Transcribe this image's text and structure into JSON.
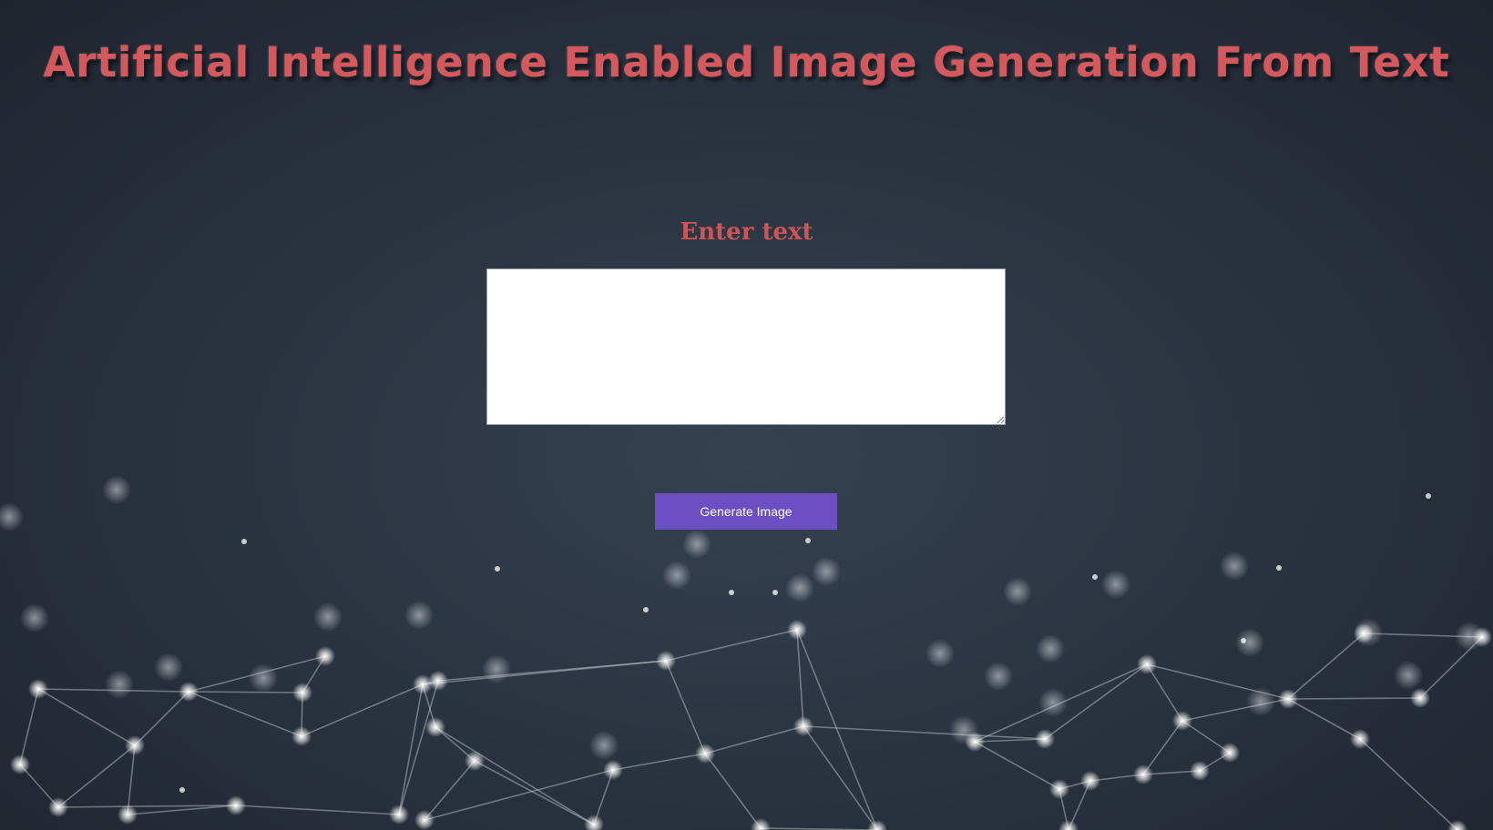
{
  "page": {
    "title": "Artificial Intelligence Enabled Image Generation From Text"
  },
  "form": {
    "label": "Enter text",
    "textarea_value": "",
    "textarea_placeholder": "",
    "submit_label": "Generate Image"
  },
  "theme": {
    "accent_text": "#d4595e",
    "button_color": "#6c4fc2",
    "background": "#2b3441"
  },
  "background_art": {
    "icon": "network-mesh-illustration"
  }
}
